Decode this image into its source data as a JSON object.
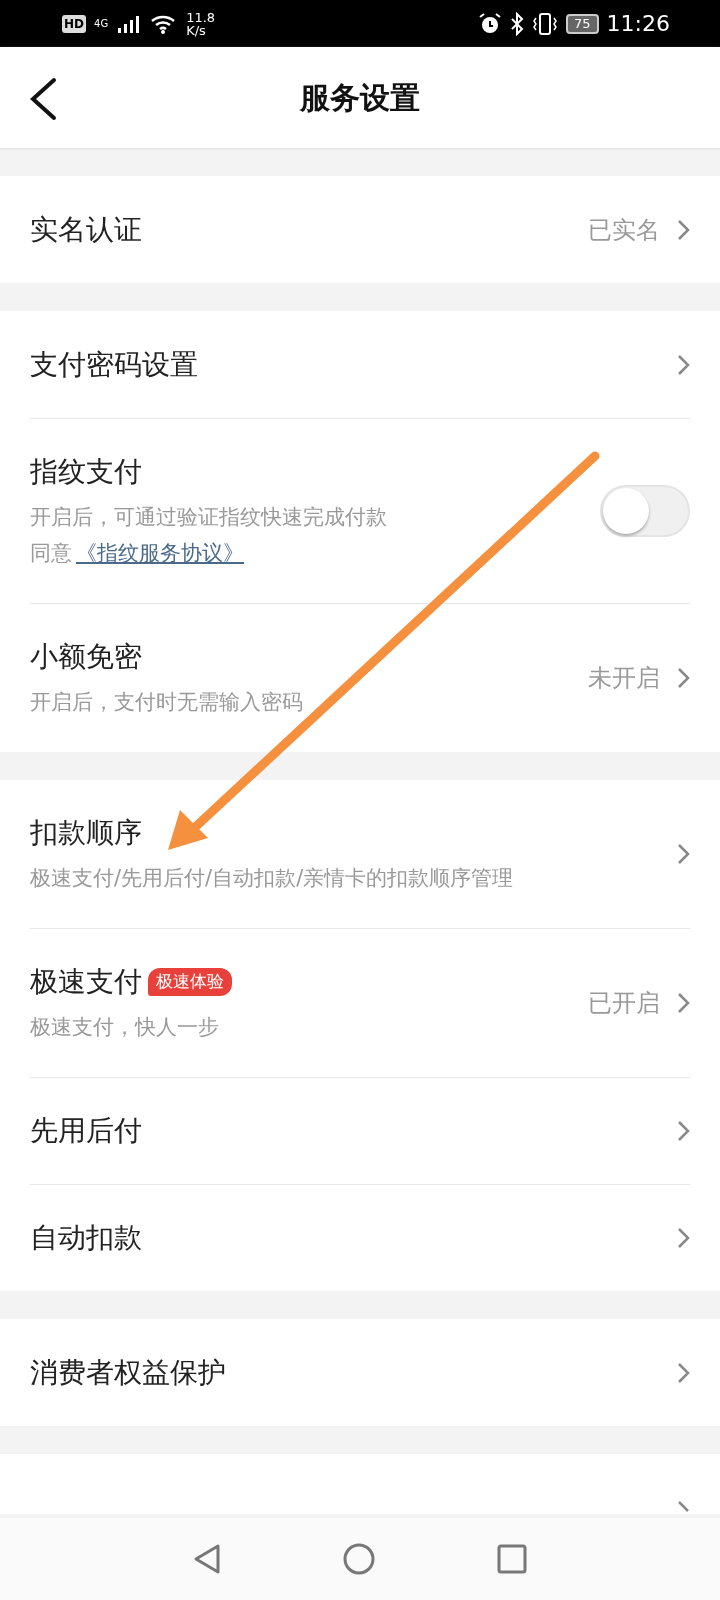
{
  "status_bar": {
    "hd": "HD",
    "network": "4G",
    "speed": "11.8",
    "speed_unit": "K/s",
    "battery": "75",
    "time": "11:26"
  },
  "header": {
    "title": "服务设置"
  },
  "groups": [
    {
      "rows": [
        {
          "kind": "link",
          "title": "实名认证",
          "value": "已实名"
        }
      ]
    },
    {
      "rows": [
        {
          "kind": "link",
          "title": "支付密码设置"
        },
        {
          "kind": "toggle",
          "title": "指纹支付",
          "subtitle": "开启后，可通过验证指纹快速完成付款",
          "agree": "同意",
          "link": "《指纹服务协议》",
          "on": false
        },
        {
          "kind": "link",
          "title": "小额免密",
          "subtitle": "开启后，支付时无需输入密码",
          "value": "未开启"
        }
      ]
    },
    {
      "rows": [
        {
          "kind": "link",
          "title": "扣款顺序",
          "subtitle": "极速支付/先用后付/自动扣款/亲情卡的扣款顺序管理"
        },
        {
          "kind": "link",
          "title": "极速支付",
          "badge": "极速体验",
          "subtitle": "极速支付，快人一步",
          "value": "已开启"
        },
        {
          "kind": "link",
          "title": "先用后付"
        },
        {
          "kind": "link",
          "title": "自动扣款"
        }
      ]
    },
    {
      "rows": [
        {
          "kind": "link",
          "title": "消费者权益保护"
        }
      ]
    },
    {
      "rows": [
        {
          "kind": "cut"
        }
      ]
    }
  ]
}
